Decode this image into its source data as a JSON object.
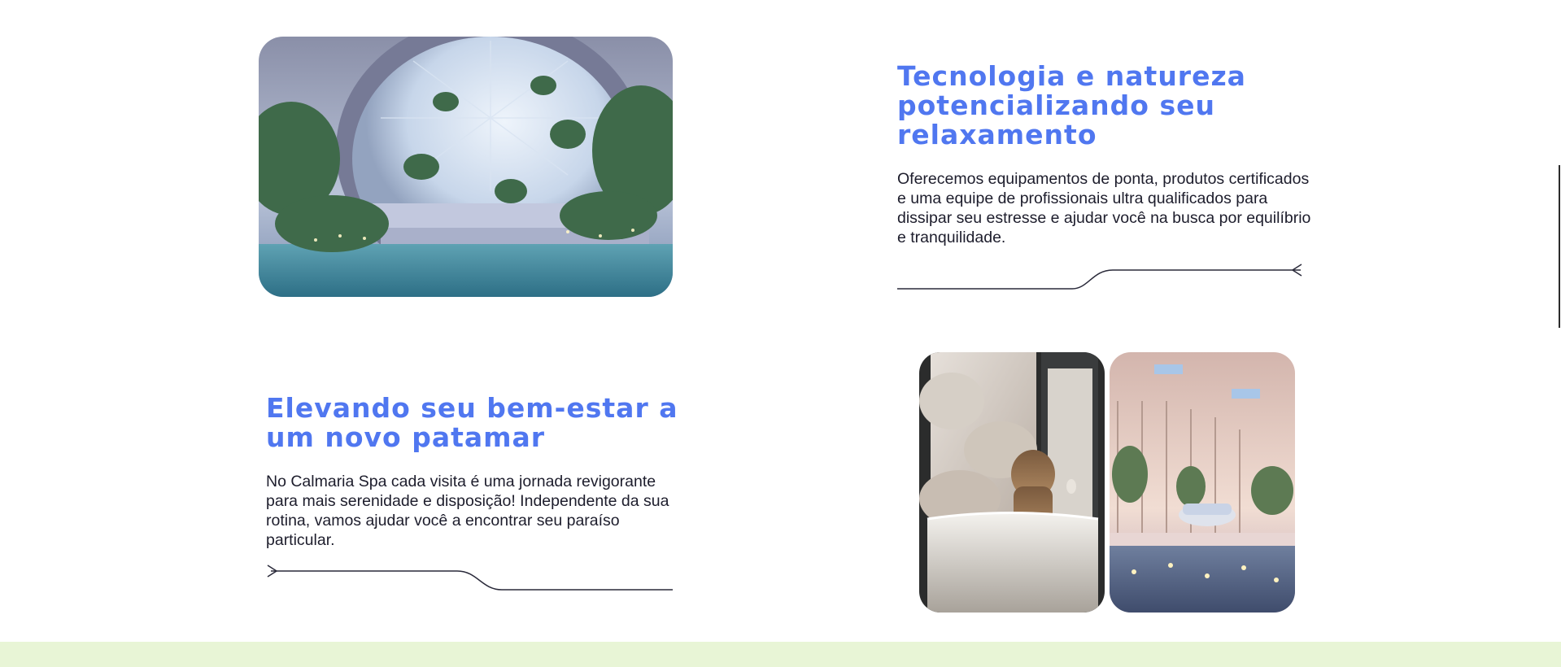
{
  "section_one": {
    "heading": "Tecnologia e natureza potencializando seu relaxamento",
    "text": "Oferecemos equipamentos de ponta, produtos certificados e uma equipe de profissionais ultra qualificados para dissipar seu estresse e ajudar você na busca por equilíbrio e tranquilidade."
  },
  "section_two": {
    "heading": "Elevando seu bem-estar a um novo patamar",
    "text": "No Calmaria Spa cada visita é uma jornada revigorante para mais serenidade e disposição! Independente da sua rotina, vamos ajudar você a encontrar seu paraíso particular."
  },
  "colors": {
    "heading": "#5077f0",
    "text": "#1d1d2c",
    "footer_band": "#e8f5d6",
    "line": "#2a2a3a"
  }
}
